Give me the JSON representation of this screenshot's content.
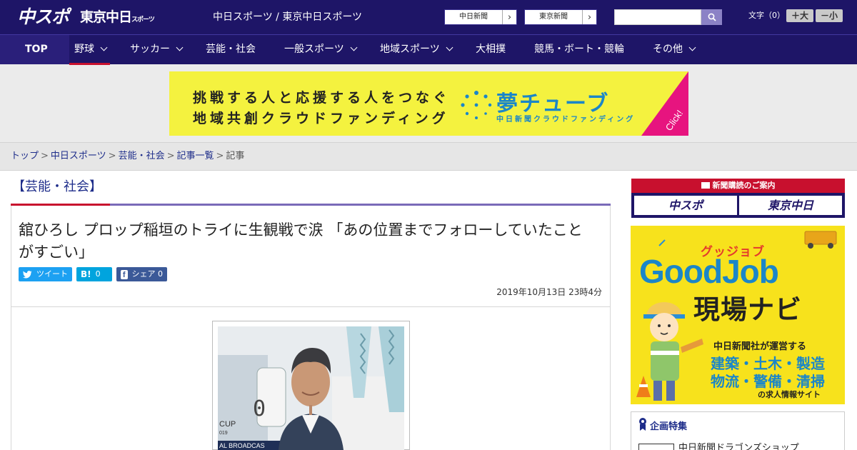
{
  "header": {
    "logo_main": "中スポ",
    "logo_tokyo": "東京中日",
    "logo_tokyo_small": "スポーツ",
    "site_links": "中日スポーツ / 東京中日スポーツ",
    "paper_links": [
      "中日新聞",
      "東京新聞"
    ],
    "font_size_label": "文字（0）",
    "font_larger": "＋大",
    "font_smaller": "－小"
  },
  "nav": {
    "items": [
      {
        "label": "TOP",
        "dropdown": false
      },
      {
        "label": "野球",
        "dropdown": true
      },
      {
        "label": "サッカー",
        "dropdown": true
      },
      {
        "label": "芸能・社会",
        "dropdown": false
      },
      {
        "label": "一般スポーツ",
        "dropdown": true
      },
      {
        "label": "地域スポーツ",
        "dropdown": true
      },
      {
        "label": "大相撲",
        "dropdown": false
      },
      {
        "label": "競馬・ボート・競輪",
        "dropdown": false
      },
      {
        "label": "その他",
        "dropdown": true
      }
    ]
  },
  "ad_banner": {
    "line1": "挑戦する人と応援する人をつなぐ",
    "line2": "地域共創クラウドファンディング",
    "brand": "夢チューブ",
    "brand_sub": "中日新聞クラウドファンディング",
    "cta": "Click!"
  },
  "breadcrumb": [
    "トップ",
    "中日スポーツ",
    "芸能・社会",
    "記事一覧",
    "記事"
  ],
  "article": {
    "section": "【芸能・社会】",
    "headline": "舘ひろし プロップ稲垣のトライに生観戦で涙 「あの位置までフォローしていたことがすごい」",
    "share": {
      "tweet": "ツイート",
      "hatena_icon": "B!",
      "hatena_count": "0",
      "facebook": "シェア",
      "facebook_count": "0"
    },
    "date": "2019年10月13日 23時4分"
  },
  "sidebar": {
    "subscription_title": "新聞購読のご案内",
    "subscription_buttons": [
      "中スポ",
      "東京中日"
    ],
    "job_ad": {
      "kana": "グッジョブ",
      "title": "GoodJob",
      "subtitle": "現場ナビ",
      "desc": "中日新聞社が運営する",
      "industries_1": "建築・土木・製造",
      "industries_2": "物流・警備・清掃",
      "tail": "の求人情報サイト"
    },
    "feature_title": "企画特集",
    "feature_item": "中日新聞ドラゴンズショップ"
  },
  "colors": {
    "brand_navy": "#1e1567",
    "accent_red": "#c8102e",
    "link_blue": "#1e2d8a",
    "banner_yellow": "#f4f23f",
    "twitter": "#1da1f2",
    "hatena": "#00a4de",
    "facebook": "#3b5998"
  }
}
